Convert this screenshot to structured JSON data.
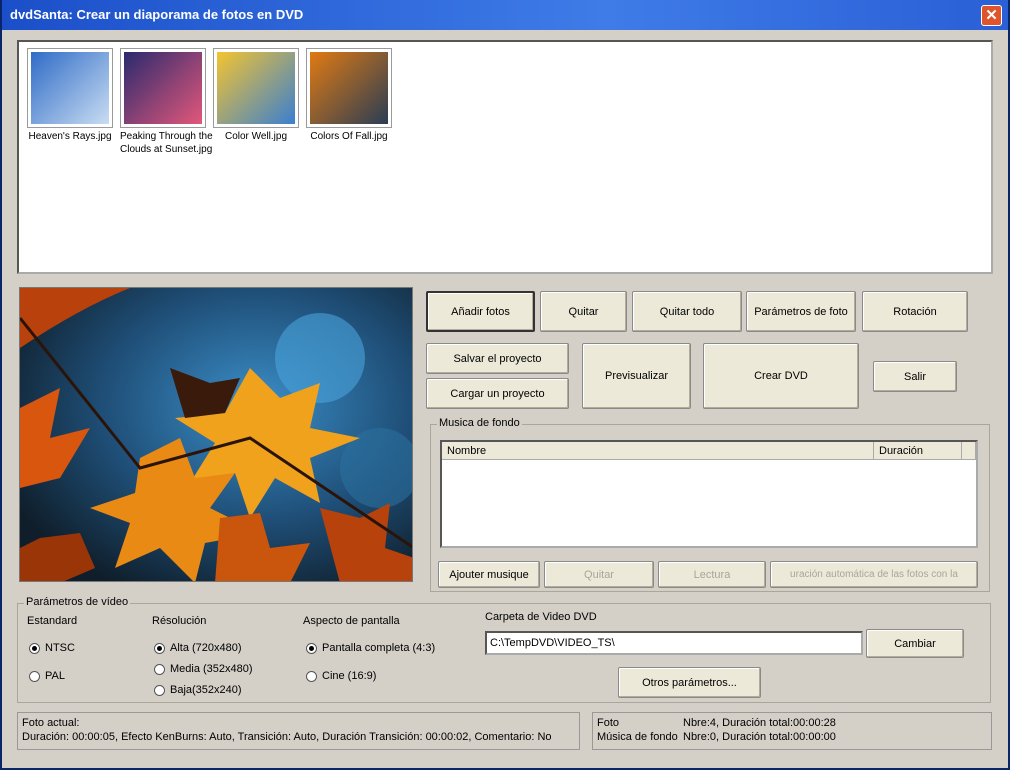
{
  "window": {
    "title": "dvdSanta: Crear un diaporama de fotos en DVD",
    "close_symbol": "✕"
  },
  "thumbnails": [
    {
      "label_line1": "Heaven's Rays.jpg",
      "label_line2": "",
      "colors": [
        "#2f6cc7",
        "#c9dcf2"
      ]
    },
    {
      "label_line1": "Peaking Through the",
      "label_line2": "Clouds at Sunset.jpg",
      "colors": [
        "#2a2a6e",
        "#e2577a"
      ]
    },
    {
      "label_line1": "Color Well.jpg",
      "label_line2": "",
      "colors": [
        "#f4c430",
        "#3a7fd0"
      ]
    },
    {
      "label_line1": "Colors Of Fall.jpg",
      "label_line2": "",
      "colors": [
        "#e07a12",
        "#2a3d55"
      ]
    }
  ],
  "buttons": {
    "add_photos": "Añadir fotos",
    "remove": "Quitar",
    "remove_all": "Quitar todo",
    "photo_params": "Parámetros de foto",
    "rotation": "Rotación",
    "save_project": "Salvar el proyecto",
    "load_project": "Cargar un proyecto",
    "preview": "Previsualizar",
    "create_dvd": "Crear DVD",
    "exit": "Salir",
    "add_music": "Ajouter musique",
    "remove_music": "Quitar",
    "read_music": "Lectura",
    "auto_duration": "uración automática de las fotos con la",
    "change": "Cambiar",
    "other_params": "Otros parámetros..."
  },
  "music": {
    "group_label": "Musica de fondo",
    "col_name": "Nombre",
    "col_duration": "Duración"
  },
  "video_params": {
    "group_label": "Parámetros de vídeo",
    "standard_label": "Estandard",
    "standard_options": [
      {
        "label": "NTSC",
        "selected": true
      },
      {
        "label": "PAL",
        "selected": false
      }
    ],
    "resolution_label": "Résolución",
    "resolution_options": [
      {
        "label": "Alta (720x480)",
        "selected": true
      },
      {
        "label": "Media (352x480)",
        "selected": false
      },
      {
        "label": "Baja(352x240)",
        "selected": false
      }
    ],
    "aspect_label": "Aspecto de pantalla",
    "aspect_options": [
      {
        "label": "Pantalla completa (4:3)",
        "selected": true
      },
      {
        "label": "Cine (16:9)",
        "selected": false
      }
    ],
    "folder_label": "Carpeta de Video DVD",
    "folder_value": "C:\\TempDVD\\VIDEO_TS\\"
  },
  "status": {
    "current_photo_title": "Foto actual:",
    "current_photo_detail": "Duración: 00:00:05, Efecto KenBurns: Auto, Transición: Auto, Duración Transición: 00:00:02, Comentario: No",
    "summary_photo_label": "Foto",
    "summary_photo_value": "Nbre:4, Duración total:00:00:28",
    "summary_music_label": "Música de fondo",
    "summary_music_value": "Nbre:0, Duración total:00:00:00"
  }
}
